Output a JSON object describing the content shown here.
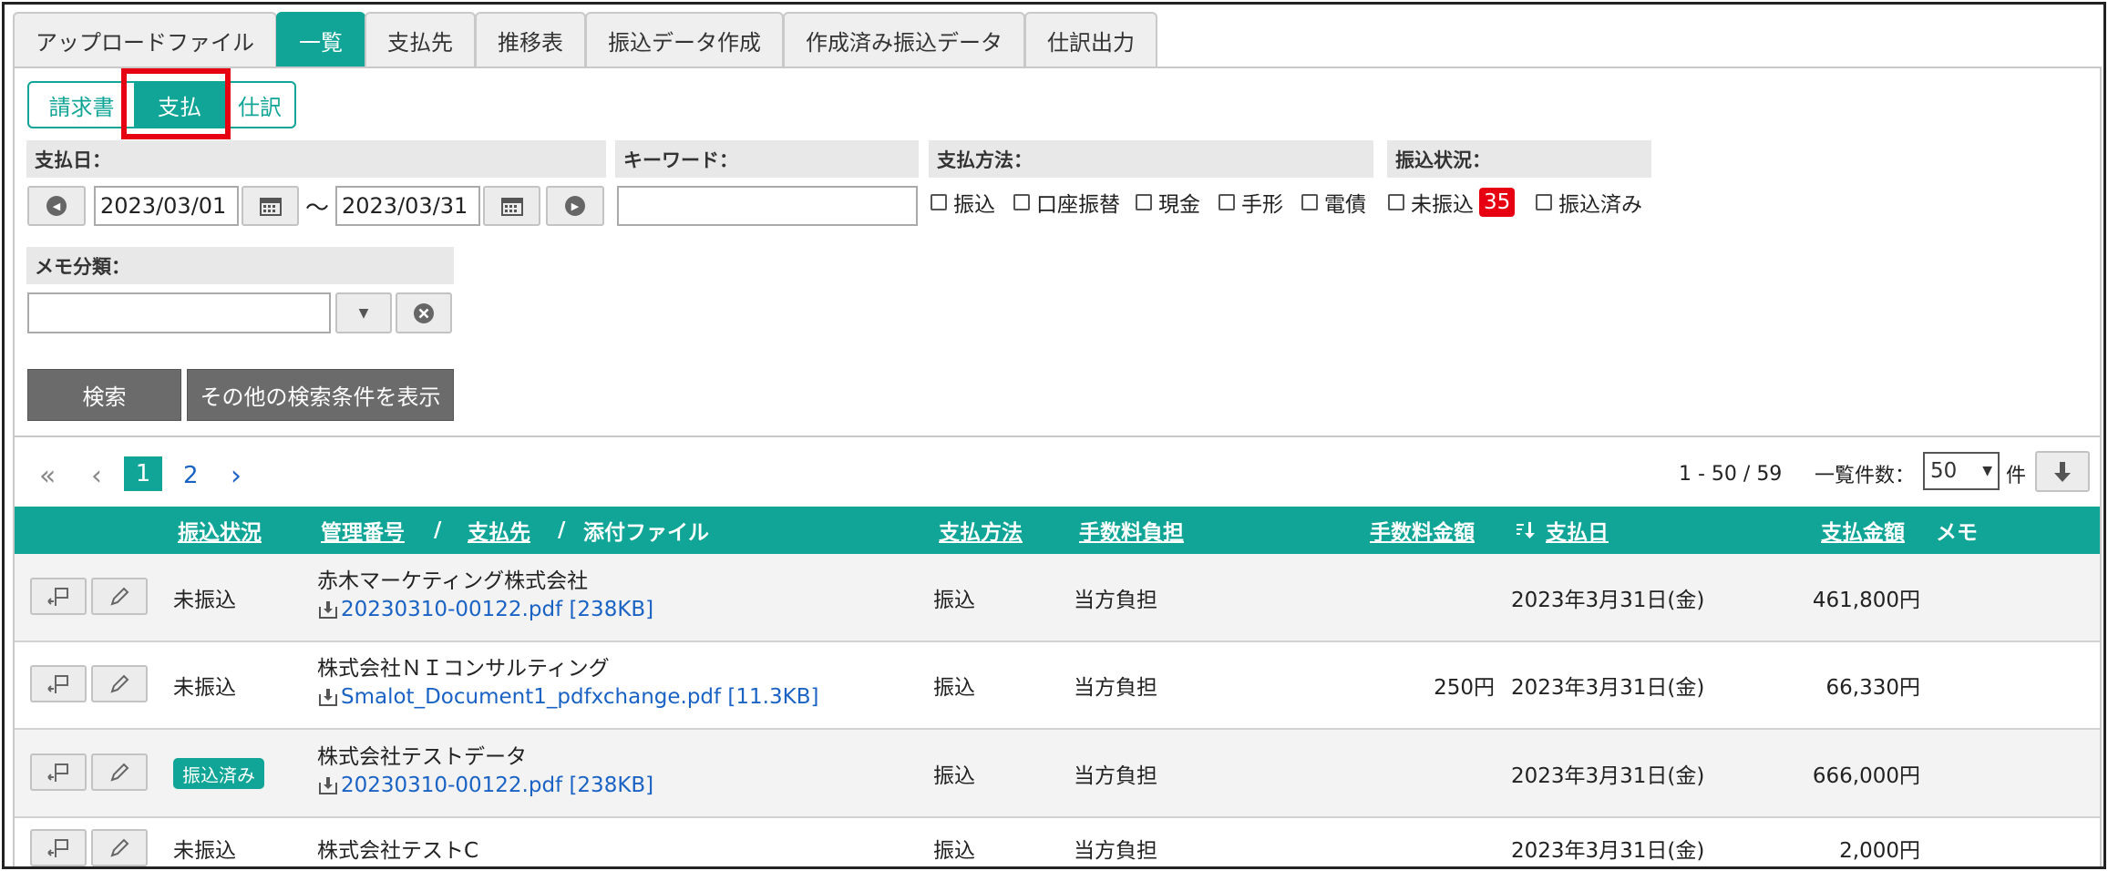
{
  "main_tabs": [
    "アップロードファイル",
    "一覧",
    "支払先",
    "推移表",
    "振込データ作成",
    "作成済み振込データ",
    "仕訳出力"
  ],
  "sub_tabs": [
    "請求書",
    "支払",
    "仕訳"
  ],
  "filters": {
    "date_label": "支払日：",
    "date_from": "2023/03/01",
    "date_separator": "～",
    "date_to": "2023/03/31",
    "keyword_label": "キーワード：",
    "keyword_value": "",
    "method_label": "支払方法：",
    "methods": [
      "振込",
      "口座振替",
      "現金",
      "手形",
      "電債"
    ],
    "status_label": "振込状況：",
    "status_unpaid": "未振込",
    "status_unpaid_count": "35",
    "status_paid": "振込済み",
    "memo_label": "メモ分類：",
    "memo_value": ""
  },
  "buttons": {
    "search": "検索",
    "more_conditions": "その他の検索条件を表示"
  },
  "pagination": {
    "first": "«",
    "prev": "‹",
    "pages": [
      "1",
      "2"
    ],
    "current": "1",
    "next": "›",
    "range_text": "1 - 50 / 59",
    "per_page_label": "一覧件数：",
    "per_page_value": "50",
    "per_page_unit": "件"
  },
  "table": {
    "headers": {
      "status": "振込状況",
      "manage_no": "管理番号",
      "slash1": "/",
      "payee": "支払先",
      "slash2": "/",
      "attachment": "添付ファイル",
      "method": "支払方法",
      "fee_burden": "手数料負担",
      "fee_amount": "手数料金額",
      "pay_date": "支払日",
      "amount": "支払金額",
      "memo": "メモ"
    },
    "rows": [
      {
        "status": "未振込",
        "status_paid": false,
        "payee": "赤木マーケティング株式会社",
        "file": "20230310-00122.pdf [238KB]",
        "method": "振込",
        "fee_burden": "当方負担",
        "fee_amount": "",
        "pay_date": "2023年3月31日(金)",
        "amount": "461,800円"
      },
      {
        "status": "未振込",
        "status_paid": false,
        "payee": "株式会社ＮＩコンサルティング",
        "file": "Smalot_Document1_pdfxchange.pdf [11.3KB]",
        "method": "振込",
        "fee_burden": "当方負担",
        "fee_amount": "250円",
        "pay_date": "2023年3月31日(金)",
        "amount": "66,330円"
      },
      {
        "status": "振込済み",
        "status_paid": true,
        "payee": "株式会社テストデータ",
        "file": "20230310-00122.pdf [238KB]",
        "method": "振込",
        "fee_burden": "当方負担",
        "fee_amount": "",
        "pay_date": "2023年3月31日(金)",
        "amount": "666,000円"
      },
      {
        "status": "未振込",
        "status_paid": false,
        "payee": "株式会社テストC",
        "file": "",
        "method": "振込",
        "fee_burden": "当方負担",
        "fee_amount": "",
        "pay_date": "2023年3月31日(金)",
        "amount": "2,000円"
      }
    ]
  },
  "colors": {
    "accent": "#10a596",
    "highlight": "#e60012",
    "link": "#1a63c5"
  }
}
